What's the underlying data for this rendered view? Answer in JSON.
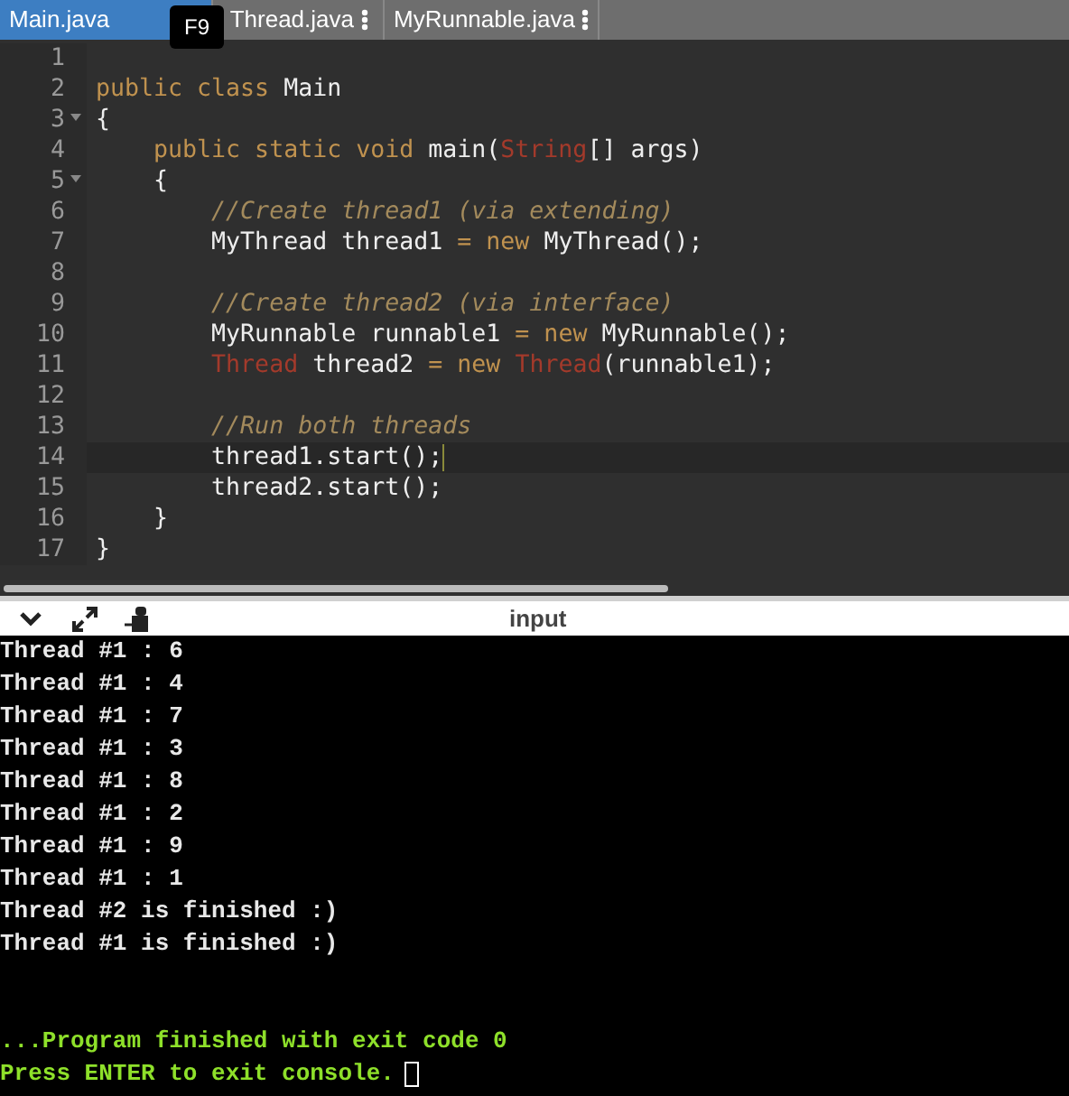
{
  "tabs": [
    {
      "label": "Main.java",
      "selected": true,
      "menu": false
    },
    {
      "label": "Thread.java",
      "selected": false,
      "menu": true
    },
    {
      "label": "MyRunnable.java",
      "selected": false,
      "menu": true
    }
  ],
  "tooltip": "F9",
  "code": [
    {
      "number": "1",
      "current": false
    },
    {
      "number": "2",
      "current": false,
      "tokens": [
        {
          "text": "public class ",
          "kind": "keyword"
        },
        {
          "text": "Main",
          "kind": "plain"
        }
      ]
    },
    {
      "number": "3",
      "current": false,
      "fold": true,
      "tokens": [
        {
          "text": "{",
          "kind": "plain"
        }
      ]
    },
    {
      "number": "4",
      "current": false,
      "tokens": [
        {
          "text": "    public static void ",
          "kind": "keyword"
        },
        {
          "text": "main(",
          "kind": "plain"
        },
        {
          "text": "String",
          "kind": "type"
        },
        {
          "text": "[] args)",
          "kind": "plain"
        }
      ]
    },
    {
      "number": "5",
      "current": false,
      "fold": true,
      "tokens": [
        {
          "text": "    {",
          "kind": "plain"
        }
      ]
    },
    {
      "number": "6",
      "current": false,
      "tokens": [
        {
          "text": "        //Create thread1 (via extending)",
          "kind": "comment"
        }
      ]
    },
    {
      "number": "7",
      "current": false,
      "tokens": [
        {
          "text": "        MyThread thread1 ",
          "kind": "plain"
        },
        {
          "text": "= new ",
          "kind": "keyword"
        },
        {
          "text": "MyThread();",
          "kind": "plain"
        }
      ]
    },
    {
      "number": "8",
      "current": false
    },
    {
      "number": "9",
      "current": false,
      "tokens": [
        {
          "text": "        //Create thread2 (via interface)",
          "kind": "comment"
        }
      ]
    },
    {
      "number": "10",
      "current": false,
      "tokens": [
        {
          "text": "        MyRunnable runnable1 ",
          "kind": "plain"
        },
        {
          "text": "= new ",
          "kind": "keyword"
        },
        {
          "text": "MyRunnable();",
          "kind": "plain"
        }
      ]
    },
    {
      "number": "11",
      "current": false,
      "tokens": [
        {
          "text": "        Thread",
          "kind": "type"
        },
        {
          "text": " thread2 ",
          "kind": "plain"
        },
        {
          "text": "= new ",
          "kind": "keyword"
        },
        {
          "text": "Thread",
          "kind": "type"
        },
        {
          "text": "(runnable1);",
          "kind": "plain"
        }
      ]
    },
    {
      "number": "12",
      "current": false
    },
    {
      "number": "13",
      "current": false,
      "tokens": [
        {
          "text": "        //Run both threads",
          "kind": "comment"
        }
      ]
    },
    {
      "number": "14",
      "current": true,
      "tokens": [
        {
          "text": "        thread1.start();",
          "kind": "plain"
        }
      ]
    },
    {
      "number": "15",
      "current": false,
      "tokens": [
        {
          "text": "        thread2.start();",
          "kind": "plain"
        }
      ]
    },
    {
      "number": "16",
      "current": false,
      "tokens": [
        {
          "text": "    }",
          "kind": "plain"
        }
      ]
    },
    {
      "number": "17",
      "current": false,
      "tokens": [
        {
          "text": "}",
          "kind": "plain"
        }
      ]
    }
  ],
  "console_header": "input",
  "console": [
    {
      "text": "Thread #1 : 6",
      "kind": "output"
    },
    {
      "text": "Thread #1 : 4",
      "kind": "output"
    },
    {
      "text": "Thread #1 : 7",
      "kind": "output"
    },
    {
      "text": "Thread #1 : 3",
      "kind": "output"
    },
    {
      "text": "Thread #1 : 8",
      "kind": "output"
    },
    {
      "text": "Thread #1 : 2",
      "kind": "output"
    },
    {
      "text": "Thread #1 : 9",
      "kind": "output"
    },
    {
      "text": "Thread #1 : 1",
      "kind": "output"
    },
    {
      "text": "Thread #2 is finished :)",
      "kind": "output"
    },
    {
      "text": "Thread #1 is finished :)",
      "kind": "output"
    },
    {
      "kind": "blank"
    },
    {
      "kind": "blank"
    },
    {
      "text": "...Program finished with exit code 0",
      "kind": "status"
    },
    {
      "text": "Press ENTER to exit console.",
      "kind": "status",
      "cursor": true
    }
  ]
}
